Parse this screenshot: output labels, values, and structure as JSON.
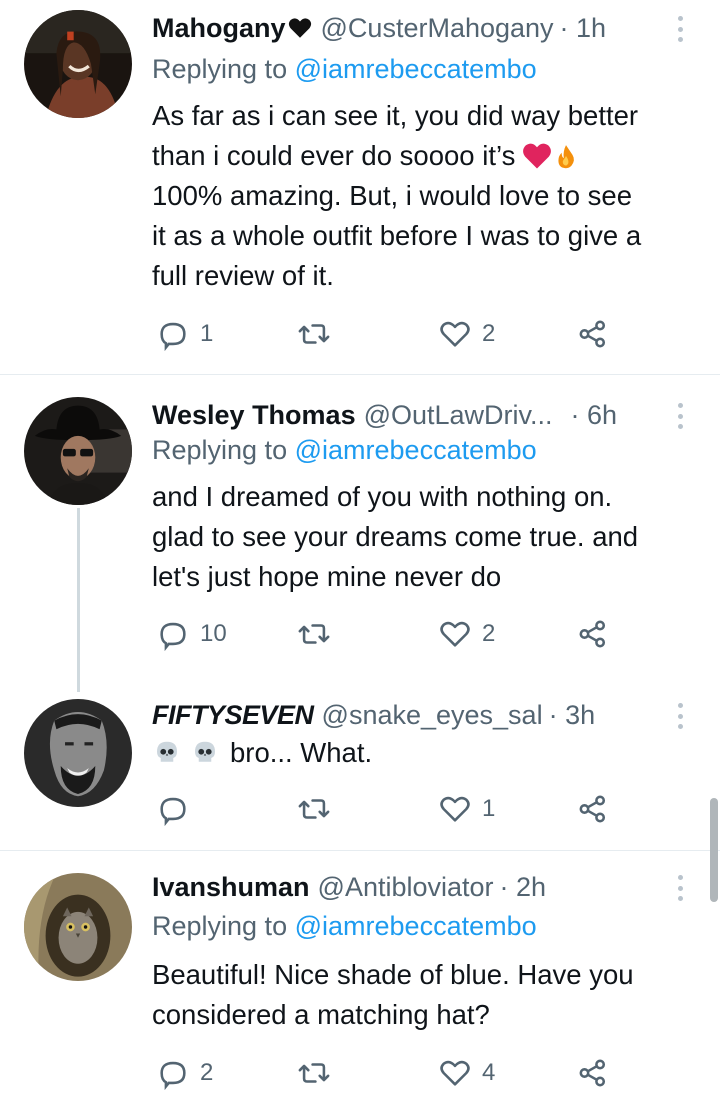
{
  "colors": {
    "link": "#1d9bf0",
    "muted": "#536471",
    "text": "#0f1419",
    "heart": "#e0245e",
    "divider": "#e6ecf0"
  },
  "icons": {
    "reply": "reply-icon",
    "retweet": "retweet-icon",
    "like": "heart-icon",
    "share": "share-icon",
    "more": "more-options-icon"
  },
  "tweets": [
    {
      "name": "Mahogany",
      "name_emoji": "black-heart",
      "handle": "@CusterMahogany",
      "time": "· 1h",
      "replying_prefix": "Replying to",
      "replying_to": "@iamrebeccatembo",
      "text_lines": [
        "As far as i can see it, you did way better",
        "than i could ever do soooo it’s",
        "100% amazing. But, i would love to see",
        "it as a whole outfit before I was to give a",
        "full review of it."
      ],
      "replies": "1",
      "retweets": "",
      "likes": "2"
    },
    {
      "name": "Wesley Thomas",
      "handle": "@OutLawDriv...",
      "time": "· 6h",
      "replying_prefix": "Replying to",
      "replying_to": "@iamrebeccatembo",
      "text_lines": [
        "and I dreamed of you with nothing on.",
        "glad to see your dreams come true. and",
        "let's just hope mine never do"
      ],
      "replies": "10",
      "retweets": "",
      "likes": "2"
    },
    {
      "name": "FIFTYSEVEN",
      "handle": "@snake_eyes_sal",
      "time": "· 3h",
      "text": "bro... What.",
      "replies": "",
      "retweets": "",
      "likes": "1"
    },
    {
      "name": "Ivanshuman",
      "handle": "@Antibloviator",
      "time": "· 2h",
      "replying_prefix": "Replying to",
      "replying_to": "@iamrebeccatembo",
      "text_lines": [
        "Beautiful! Nice shade of blue. Have you",
        "considered a matching hat?"
      ],
      "replies": "2",
      "retweets": "",
      "likes": "4"
    }
  ]
}
